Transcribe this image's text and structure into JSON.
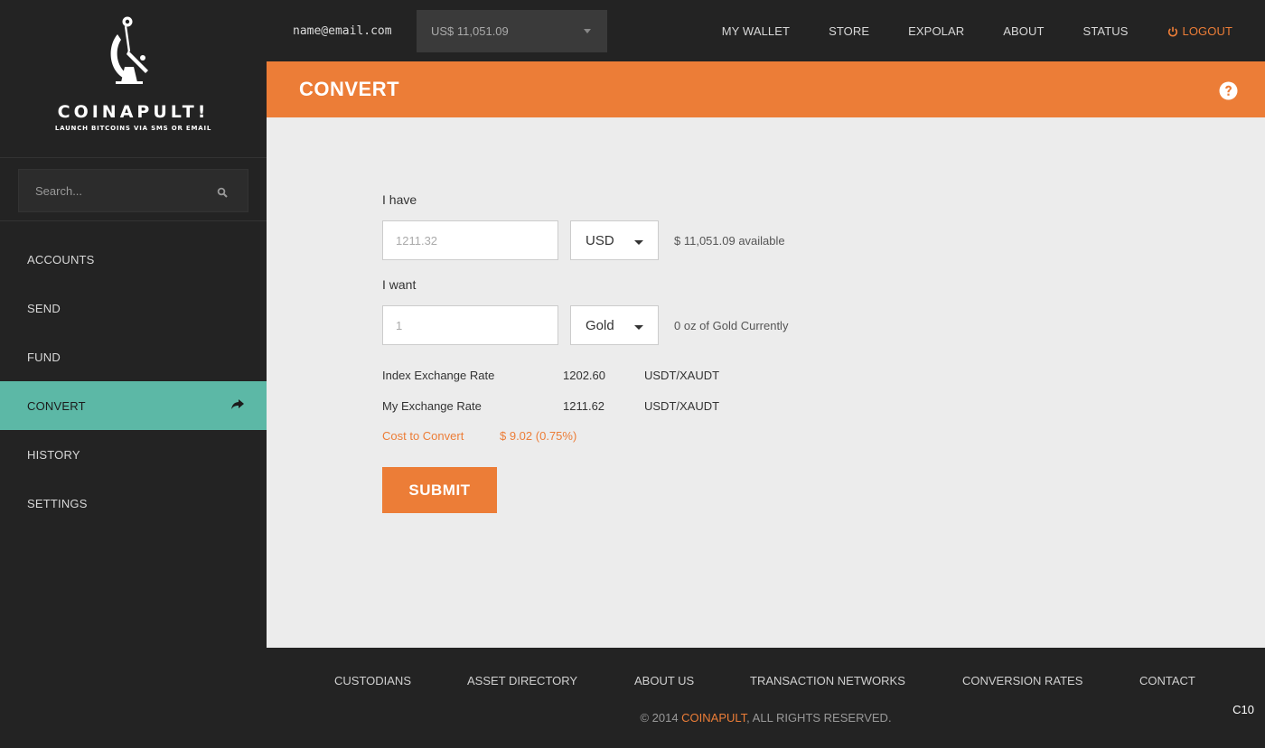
{
  "brand": {
    "name": "COINAPULT!",
    "tagline": "LAUNCH BITCOINS VIA SMS OR EMAIL",
    "accent_color": "#ec7d37",
    "active_color": "#5cb8a6"
  },
  "sidebar": {
    "search_placeholder": "Search...",
    "items": [
      {
        "label": "ACCOUNTS"
      },
      {
        "label": "SEND"
      },
      {
        "label": "FUND"
      },
      {
        "label": "CONVERT",
        "active": true,
        "icon": "share-icon"
      },
      {
        "label": "HISTORY"
      },
      {
        "label": "SETTINGS"
      }
    ]
  },
  "topbar": {
    "email": "name@email.com",
    "balance": "US$ 11,051.09",
    "nav": [
      "MY WALLET",
      "STORE",
      "EXPOLAR",
      "ABOUT",
      "STATUS"
    ],
    "logout": "LOGOUT"
  },
  "header": {
    "title": "CONVERT",
    "help_icon": "question-circle-icon"
  },
  "form": {
    "have_label": "I have",
    "have_value_placeholder": "1211.32",
    "have_currency": "USD",
    "have_note": "$ 11,051.09 available",
    "want_label": "I want",
    "want_value_placeholder": "1",
    "want_currency": "Gold",
    "want_note": "0 oz of Gold Currently",
    "rates": [
      {
        "label": "Index Exchange Rate",
        "value": "1202.60",
        "pair": "USDT/XAUDT"
      },
      {
        "label": "My Exchange Rate",
        "value": "1211.62",
        "pair": "USDT/XAUDT"
      }
    ],
    "cost_label": "Cost to Convert",
    "cost_value": "$ 9.02 (0.75%)",
    "submit": "SUBMIT"
  },
  "footer": {
    "links": [
      "CUSTODIANS",
      "ASSET DIRECTORY",
      "ABOUT US",
      "TRANSACTION NETWORKS",
      "CONVERSION RATES",
      "CONTACT"
    ],
    "copyright_prefix": "© 2014 ",
    "copyright_brand": "COINAPULT",
    "copyright_suffix": ", ALL RIGHTS RESERVED.",
    "corner_label": "C10"
  }
}
